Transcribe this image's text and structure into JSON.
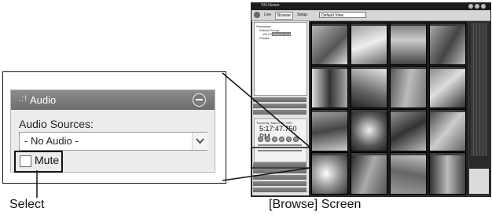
{
  "audio_panel": {
    "title": "Audio",
    "sources_label": "Audio Sources:",
    "selected_source": "- No Audio -",
    "mute_label": "Mute"
  },
  "captions": {
    "select": "Select",
    "browse_screen": "[Browse] Screen"
  },
  "app": {
    "title": "VN-Viewer",
    "toolbar": {
      "live": "Live",
      "browse": "Browse",
      "setup": "Setup",
      "view": "Default View"
    },
    "tree": {
      "root": "Showcase",
      "group": "Default Group",
      "camera": "VN-C215",
      "selected": "Default View",
      "other": "Private"
    },
    "playback": {
      "date": "Thursday, March 22, 2007",
      "time": "5:17:47.750 PM"
    }
  }
}
